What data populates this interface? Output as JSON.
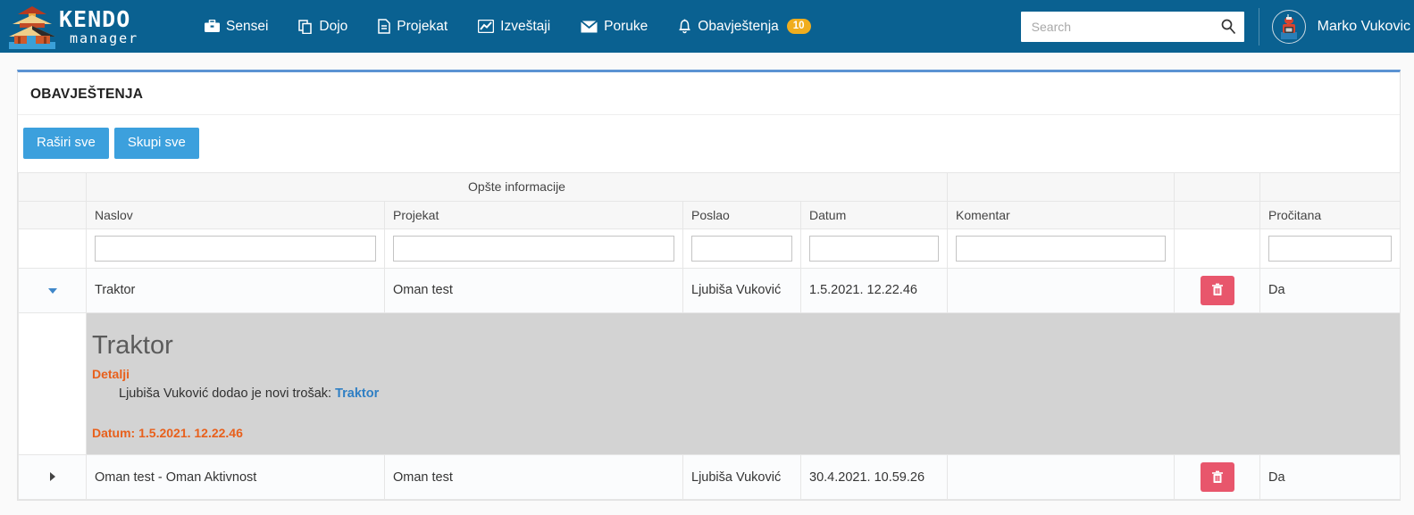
{
  "brand": {
    "logo_primary": "KENDO",
    "logo_secondary": "manager",
    "logo_icon": "pagoda-icon"
  },
  "nav": {
    "items": [
      {
        "label": "Sensei",
        "icon": "briefcase-icon"
      },
      {
        "label": "Dojo",
        "icon": "copy-icon"
      },
      {
        "label": "Projekat",
        "icon": "document-icon"
      },
      {
        "label": "Izveštaji",
        "icon": "chart-line-icon"
      },
      {
        "label": "Poruke",
        "icon": "envelope-icon"
      },
      {
        "label": "Obavještenja",
        "icon": "bell-icon",
        "badge": "10"
      }
    ]
  },
  "search": {
    "value": "",
    "placeholder": "Search",
    "icon": "search-icon"
  },
  "user": {
    "name": "Marko Vukovic",
    "avatar": "samurai-avatar"
  },
  "panel": {
    "title": "OBAVJEŠTENJA",
    "buttons": [
      {
        "label": "Raširi sve",
        "name": "expand-all-button"
      },
      {
        "label": "Skupi sve",
        "name": "collapse-all-button"
      }
    ]
  },
  "grid": {
    "group_header": "Opšte informacije",
    "columns": [
      {
        "label": "Naslov",
        "key": "naslov"
      },
      {
        "label": "Projekat",
        "key": "projekat"
      },
      {
        "label": "Poslao",
        "key": "poslao"
      },
      {
        "label": "Datum",
        "key": "datum"
      },
      {
        "label": "Komentar",
        "key": "komentar"
      },
      {
        "label": "",
        "key": "akcija"
      },
      {
        "label": "Pročitana",
        "key": "procitana"
      }
    ],
    "filters": {
      "naslov": "",
      "projekat": "",
      "poslao": "",
      "datum": "",
      "komentar": "",
      "procitana": ""
    },
    "rows": [
      {
        "expanded": true,
        "naslov": "Traktor",
        "projekat": "Oman test",
        "poslao": "Ljubiša Vuković",
        "datum": "1.5.2021. 12.22.46",
        "komentar": "",
        "procitana": "Da",
        "detail": {
          "title": "Traktor",
          "details_label": "Detalji",
          "body_text": "Ljubiša Vuković dodao je novi trošak:",
          "body_link": "Traktor",
          "date_text": "Datum: 1.5.2021. 12.22.46"
        }
      },
      {
        "expanded": false,
        "naslov": "Oman test - Oman Aktivnost",
        "projekat": "Oman test",
        "poslao": "Ljubiša Vuković",
        "datum": "30.4.2021. 10.59.26",
        "komentar": "",
        "procitana": "Da"
      }
    ]
  },
  "colors": {
    "header_bg": "#0a6191",
    "accent_blue": "#3ca0dd",
    "panel_top_border": "#5b93d3",
    "badge_yellow": "#f0ad1e",
    "delete_red": "#e8566c",
    "detail_orange": "#e8601c",
    "detail_link_blue": "#2f7fc4",
    "detail_bg": "#d3d3d3"
  }
}
